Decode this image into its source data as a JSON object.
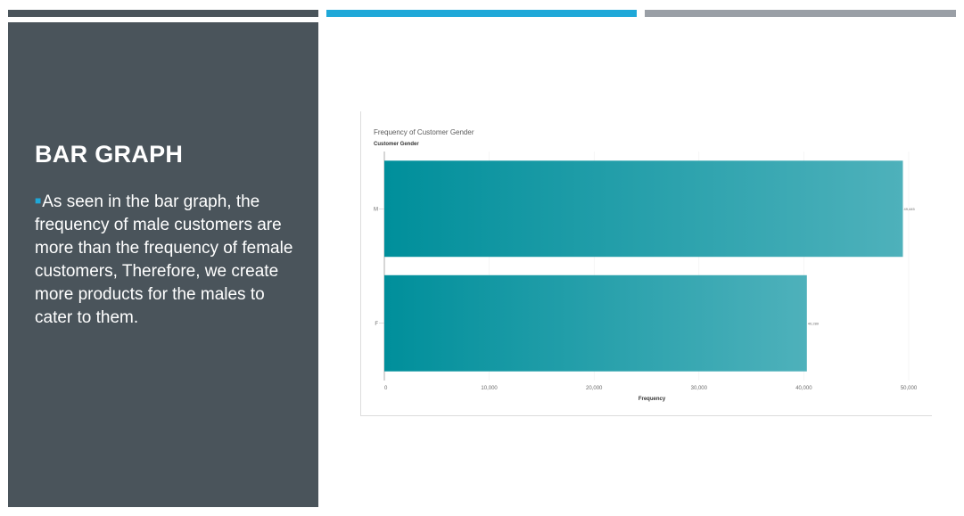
{
  "colors": {
    "dark_bar": "#4a545b",
    "blue_bar": "#1fa8d8",
    "gray_bar": "#9a9fa6",
    "panel": "#4a545b",
    "bar_start": "#008f9b",
    "bar_end": "#4eb1bb"
  },
  "slide": {
    "title": "BAR GRAPH",
    "bullet_icon": "square-bullet",
    "body": "As seen in the bar graph, the frequency of male customers are more than the frequency of female customers, Therefore, we create more products for the males to cater to them."
  },
  "chart_data": {
    "type": "bar",
    "orientation": "horizontal",
    "title": "Frequency of Customer Gender",
    "ylabel": "Customer Gender",
    "xlabel": "Frequency",
    "categories": [
      "M",
      "F"
    ],
    "values": [
      49445,
      40289
    ],
    "data_labels": [
      "49,445",
      "40,289"
    ],
    "xlim": [
      0,
      50000
    ],
    "xticks": [
      0,
      10000,
      20000,
      30000,
      40000,
      50000
    ],
    "xtick_labels": [
      "0",
      "10,000",
      "20,000",
      "30,000",
      "40,000",
      "50,000"
    ],
    "grid": true
  }
}
